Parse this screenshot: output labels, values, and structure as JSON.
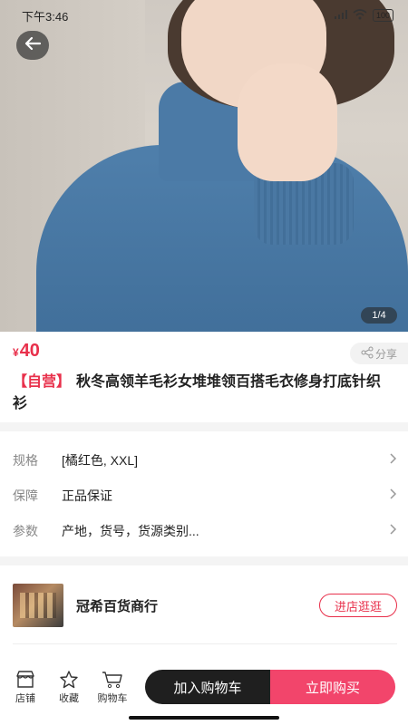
{
  "status_bar": {
    "time": "下午3:46",
    "battery": "100"
  },
  "gallery": {
    "page_indicator": "1/4"
  },
  "product": {
    "currency": "¥",
    "price": "40",
    "share_label": "分享",
    "tag": "【自营】",
    "title": "秋冬高领羊毛衫女堆堆领百搭毛衣修身打底针织衫"
  },
  "specs": [
    {
      "key": "规格",
      "value": "[橘红色, XXL]"
    },
    {
      "key": "保障",
      "value": "正品保证"
    },
    {
      "key": "参数",
      "value": "产地，货号，货源类别..."
    }
  ],
  "shop": {
    "name": "冠希百货商行",
    "visit_label": "进店逛逛"
  },
  "bottom_bar": {
    "nav": [
      {
        "label": "店铺",
        "icon": "store-icon"
      },
      {
        "label": "收藏",
        "icon": "star-icon"
      },
      {
        "label": "购物车",
        "icon": "cart-icon"
      }
    ],
    "add_to_cart": "加入购物车",
    "buy_now": "立即购买"
  },
  "colors": {
    "accent": "#e8304b",
    "buy": "#f2456b",
    "cart": "#1f1f1f"
  }
}
